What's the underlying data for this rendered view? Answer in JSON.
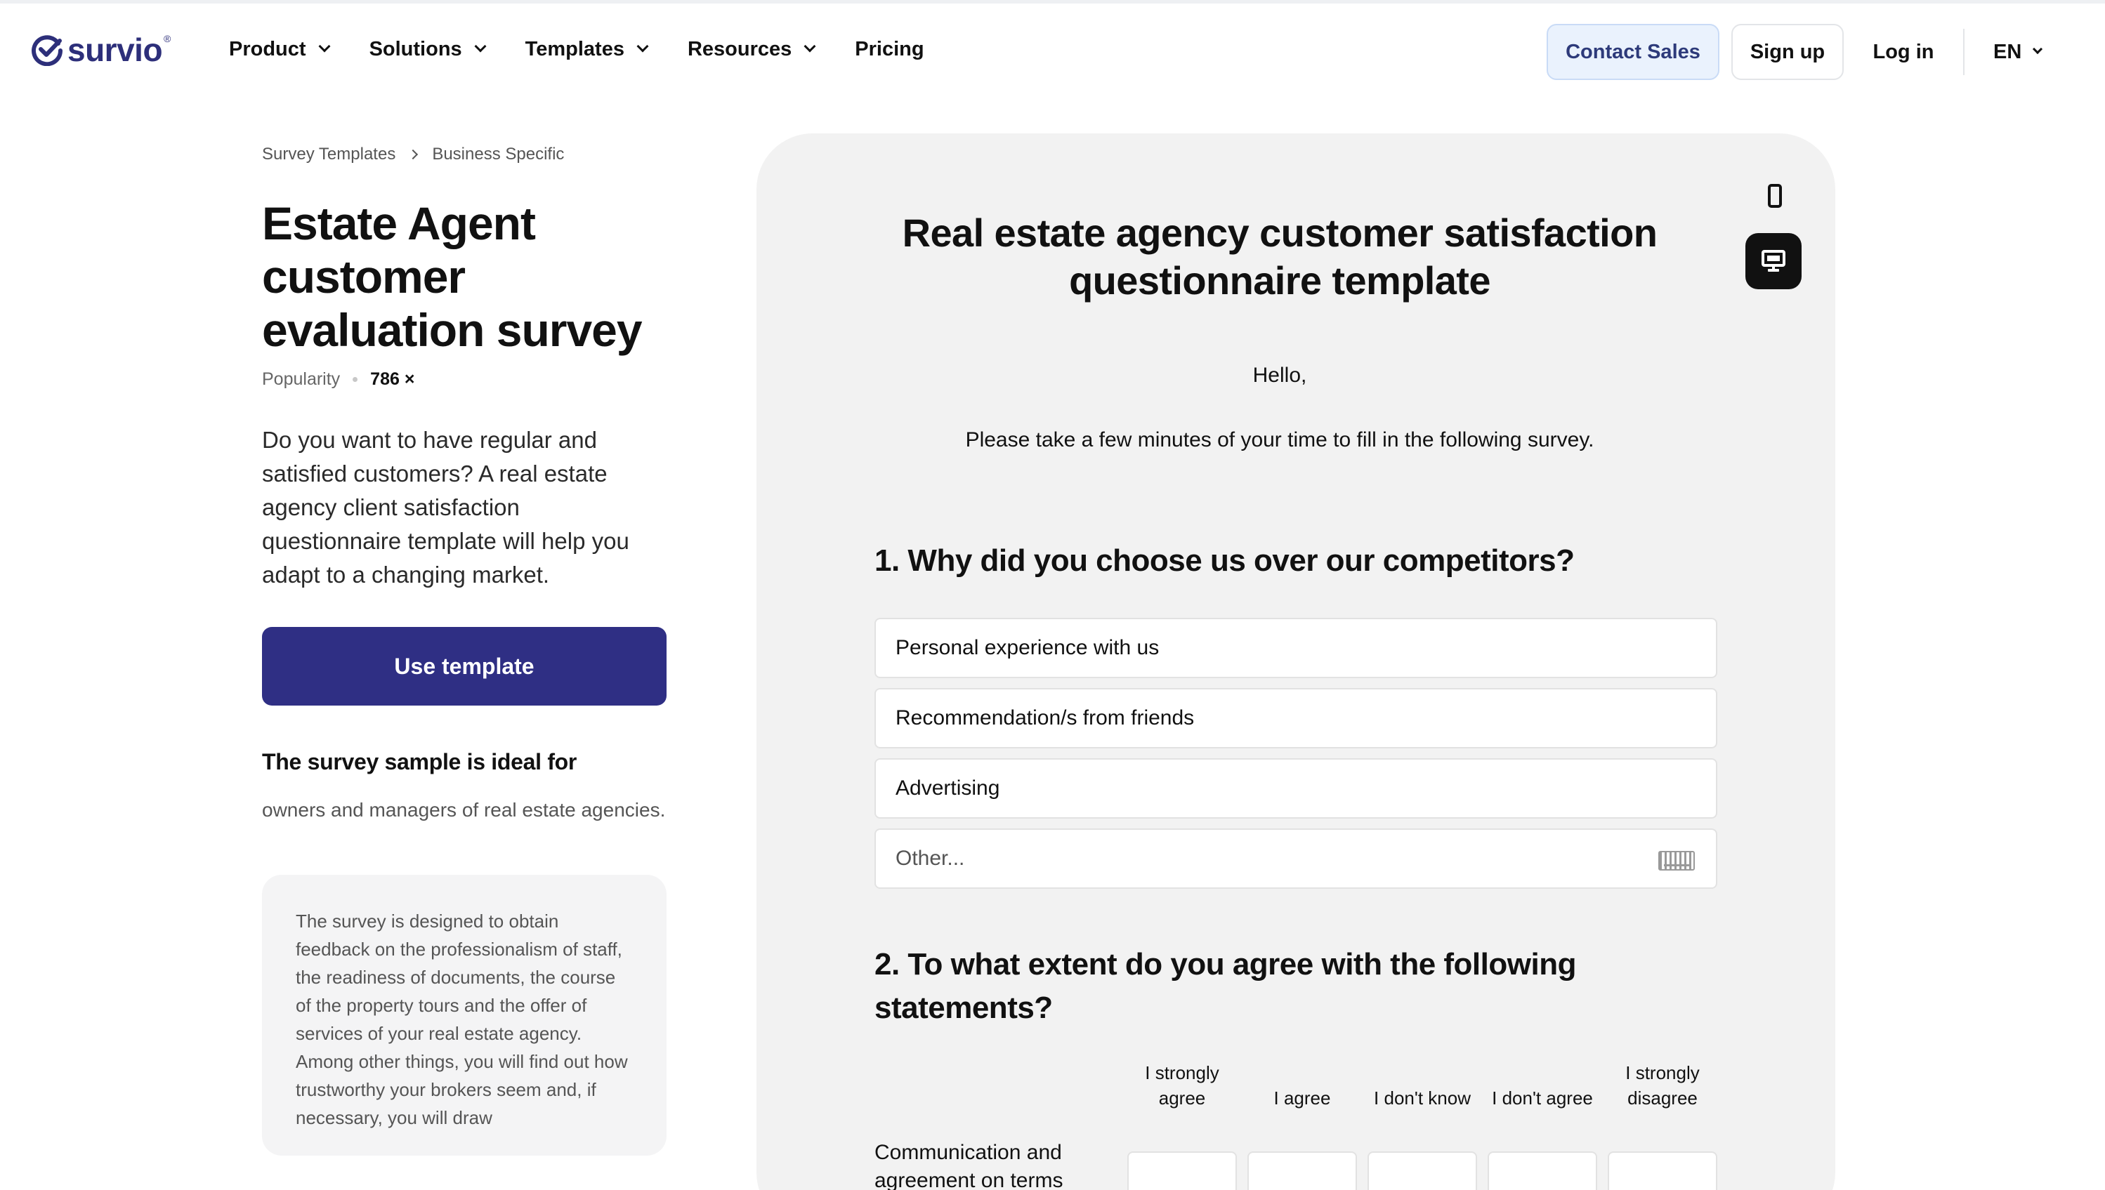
{
  "brand": {
    "name": "survio",
    "reg": "®",
    "color": "#2d2f7a"
  },
  "nav": {
    "items": [
      {
        "label": "Product",
        "dropdown": true
      },
      {
        "label": "Solutions",
        "dropdown": true
      },
      {
        "label": "Templates",
        "dropdown": true
      },
      {
        "label": "Resources",
        "dropdown": true
      },
      {
        "label": "Pricing",
        "dropdown": false
      }
    ],
    "contact_sales": "Contact Sales",
    "sign_up": "Sign up",
    "log_in": "Log in",
    "language": "EN"
  },
  "breadcrumb": [
    "Survey Templates",
    "Business Specific"
  ],
  "template": {
    "title": "Estate Agent customer evaluation survey",
    "popularity_label": "Popularity",
    "popularity_value": "786 ×",
    "intro": "Do you want to have regular and satisfied customers? A real estate agency client satisfaction questionnaire template will help you adapt to a changing market.",
    "use_button": "Use template",
    "accent_color": "#2f2f84",
    "ideal_heading": "The survey sample is ideal for",
    "ideal_text": "owners and managers of real estate agencies.",
    "description": "The survey is designed to obtain feedback on the professionalism of staff, the readiness of documents, the course of the property tours and the offer of services of your real estate agency. Among other things, you will find out how trustworthy your brokers seem and, if necessary, you will draw"
  },
  "preview": {
    "devices": [
      "mobile-icon",
      "desktop-icon"
    ],
    "active_device": "desktop",
    "survey_title": "Real estate agency customer satisfaction questionnaire template",
    "greeting": "Hello,",
    "intro": "Please take a few minutes of your time to fill in the following survey.",
    "q1": {
      "title": "1. Why did you choose us over our competitors?",
      "options": [
        "Personal experience with us",
        "Recommendation/s from friends",
        "Advertising"
      ],
      "other_placeholder": "Other..."
    },
    "q2": {
      "title": "2. To what extent do you agree with the following statements?",
      "columns": [
        "I strongly agree",
        "I agree",
        "I don't know",
        "I don't agree",
        "I strongly disagree"
      ],
      "rows": [
        "Communication and agreement on terms"
      ]
    }
  }
}
